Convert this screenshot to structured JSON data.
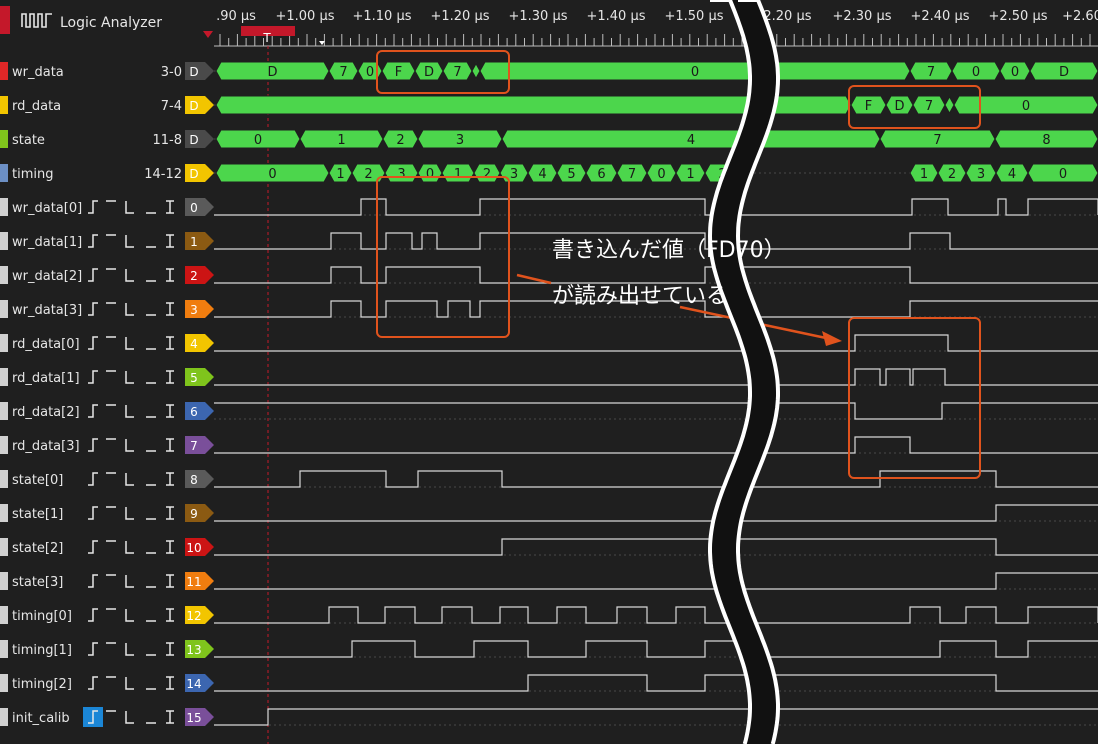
{
  "app": {
    "title": "Logic Analyzer"
  },
  "timeline": {
    "ticks_left": [
      ".90 μs",
      "+1.00 μs",
      "+1.10 μs",
      "+1.20 μs",
      "+1.30 μs",
      "+1.40 μs",
      "+1.50 μs"
    ],
    "ticks_right": [
      "+2.20 μs",
      "+2.30 μs",
      "+2.40 μs",
      "+2.50 μs",
      "+2.60"
    ],
    "trigger_label": "T"
  },
  "buses": [
    {
      "name": "wr_data",
      "range": "3-0",
      "badge": "D",
      "color": "#e02727",
      "badge_color": "#4a4a4a"
    },
    {
      "name": "rd_data",
      "range": "7-4",
      "badge": "D",
      "color": "#f2c500",
      "badge_color": "#f2c500"
    },
    {
      "name": "state",
      "range": "11-8",
      "badge": "D",
      "color": "#7fc41c",
      "badge_color": "#4a4a4a"
    },
    {
      "name": "timing",
      "range": "14-12",
      "badge": "D",
      "color": "#6c8fc4",
      "badge_color": "#f2c500"
    }
  ],
  "bus_values": {
    "wr_data": [
      "D",
      "7",
      "0",
      "F",
      "D",
      "7",
      "0",
      "7",
      "0",
      "0",
      "D"
    ],
    "rd_data": [
      "F",
      "D",
      "7",
      "0"
    ],
    "state": [
      "0",
      "1",
      "2",
      "3",
      "4",
      "7",
      "8"
    ],
    "timing": [
      "0",
      "1",
      "2",
      "3",
      "0",
      "1",
      "2",
      "3",
      "4",
      "5",
      "6",
      "7",
      "0",
      "1",
      "2",
      "1",
      "2",
      "3",
      "4",
      "0"
    ]
  },
  "signals": [
    {
      "name": "wr_data[0]",
      "channel": "0",
      "color": "#5a5a5a"
    },
    {
      "name": "wr_data[1]",
      "channel": "1",
      "color": "#8b5a12"
    },
    {
      "name": "wr_data[2]",
      "channel": "2",
      "color": "#cc1414"
    },
    {
      "name": "wr_data[3]",
      "channel": "3",
      "color": "#f07d0f"
    },
    {
      "name": "rd_data[0]",
      "channel": "4",
      "color": "#f2c500"
    },
    {
      "name": "rd_data[1]",
      "channel": "5",
      "color": "#7fc41c"
    },
    {
      "name": "rd_data[2]",
      "channel": "6",
      "color": "#3c66b0"
    },
    {
      "name": "rd_data[3]",
      "channel": "7",
      "color": "#7a4f9a"
    },
    {
      "name": "state[0]",
      "channel": "8",
      "color": "#5a5a5a"
    },
    {
      "name": "state[1]",
      "channel": "9",
      "color": "#8b5a12"
    },
    {
      "name": "state[2]",
      "channel": "10",
      "color": "#cc1414"
    },
    {
      "name": "state[3]",
      "channel": "11",
      "color": "#f07d0f"
    },
    {
      "name": "timing[0]",
      "channel": "12",
      "color": "#f2c500"
    },
    {
      "name": "timing[1]",
      "channel": "13",
      "color": "#7fc41c"
    },
    {
      "name": "timing[2]",
      "channel": "14",
      "color": "#3c66b0"
    },
    {
      "name": "init_calib",
      "channel": "15",
      "color": "#7a4f9a"
    }
  ],
  "annotation": {
    "line1": "書き込んだ値（FD70）",
    "line2": "が読み出せている"
  },
  "colors": {
    "bus_fill": "#4cd64c",
    "waveform": "#d8d8d8",
    "highlight": "#e0531d",
    "background": "#1f1f1f",
    "accent": "#c4182a"
  }
}
